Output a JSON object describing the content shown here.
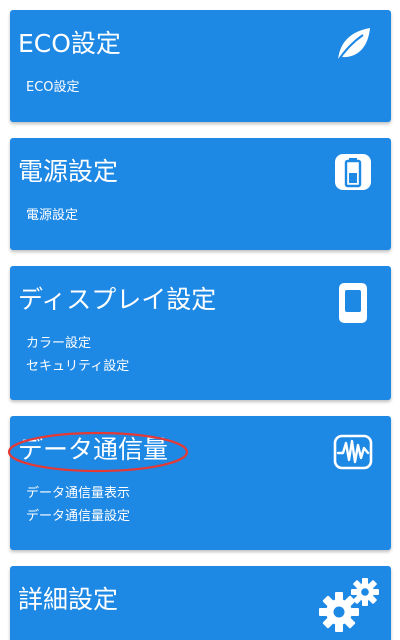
{
  "colors": {
    "card_background": "#1e88e5",
    "card_text": "#ffffff",
    "highlight": "#e53935"
  },
  "cards": [
    {
      "title": "ECO設定",
      "icon": "leaf-icon",
      "items": [
        "ECO設定"
      ]
    },
    {
      "title": "電源設定",
      "icon": "battery-icon",
      "items": [
        "電源設定"
      ]
    },
    {
      "title": "ディスプレイ設定",
      "icon": "phone-screen-icon",
      "items": [
        "カラー設定",
        "セキュリティ設定"
      ]
    },
    {
      "title": "データ通信量",
      "icon": "waveform-icon",
      "items": [
        "データ通信量表示",
        "データ通信量設定"
      ]
    },
    {
      "title": "詳細設定",
      "icon": "gears-icon",
      "items": []
    }
  ]
}
